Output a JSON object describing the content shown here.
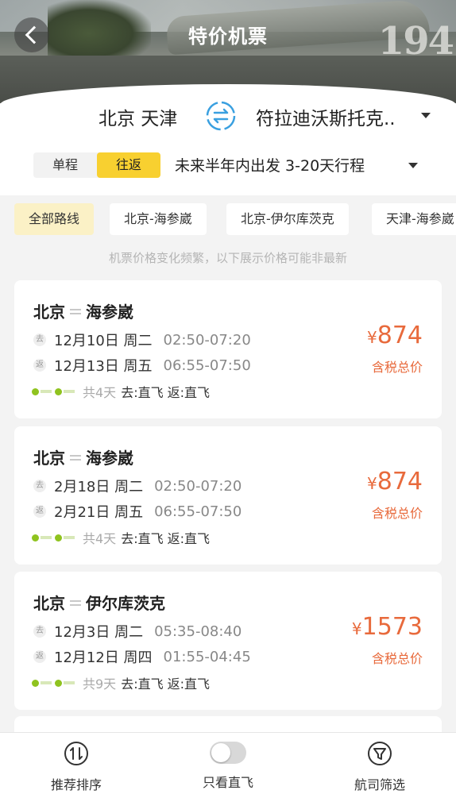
{
  "header": {
    "title": "特价机票",
    "photo_text": "194"
  },
  "search": {
    "from_city": "北京 天津",
    "to_city": "符拉迪沃斯托克..",
    "trip_types": [
      "单程",
      "往返"
    ],
    "active_trip_type": "往返",
    "date_range": "未来半年内出发 3-20天行程"
  },
  "routes": {
    "chips": [
      "全部路线",
      "北京-海参崴",
      "北京-伊尔库茨克",
      "天津-海参崴"
    ],
    "active_chip": "全部路线",
    "notice": "机票价格变化频繁，以下展示价格可能非最新"
  },
  "cards": [
    {
      "from": "北京",
      "to": "海参崴",
      "out_tag": "去",
      "out_date": "12月10日 周二",
      "out_time": "02:50-07:20",
      "ret_tag": "返",
      "ret_date": "12月13日 周五",
      "ret_time": "06:55-07:50",
      "days": "共4天",
      "stops": "去:直飞 返:直飞",
      "currency": "¥",
      "price": "874",
      "price_note": "含税总价"
    },
    {
      "from": "北京",
      "to": "海参崴",
      "out_tag": "去",
      "out_date": "2月18日 周二",
      "out_time": "02:50-07:20",
      "ret_tag": "返",
      "ret_date": "2月21日 周五",
      "ret_time": "06:55-07:50",
      "days": "共4天",
      "stops": "去:直飞 返:直飞",
      "currency": "¥",
      "price": "874",
      "price_note": "含税总价"
    },
    {
      "from": "北京",
      "to": "伊尔库茨克",
      "out_tag": "去",
      "out_date": "12月3日 周二",
      "out_time": "05:35-08:40",
      "ret_tag": "返",
      "ret_date": "12月12日 周四",
      "ret_time": "01:55-04:45",
      "days": "共9天",
      "stops": "去:直飞 返:直飞",
      "currency": "¥",
      "price": "1573",
      "price_note": "含税总价"
    }
  ],
  "bottom_bar": {
    "sort_label": "推荐排序",
    "direct_label": "只看直飞",
    "direct_only": false,
    "filter_label": "航司筛选"
  },
  "colors": {
    "accent_yellow": "#f8d030",
    "price_orange": "#e86a3c",
    "swap_blue": "#3aa0e0"
  }
}
